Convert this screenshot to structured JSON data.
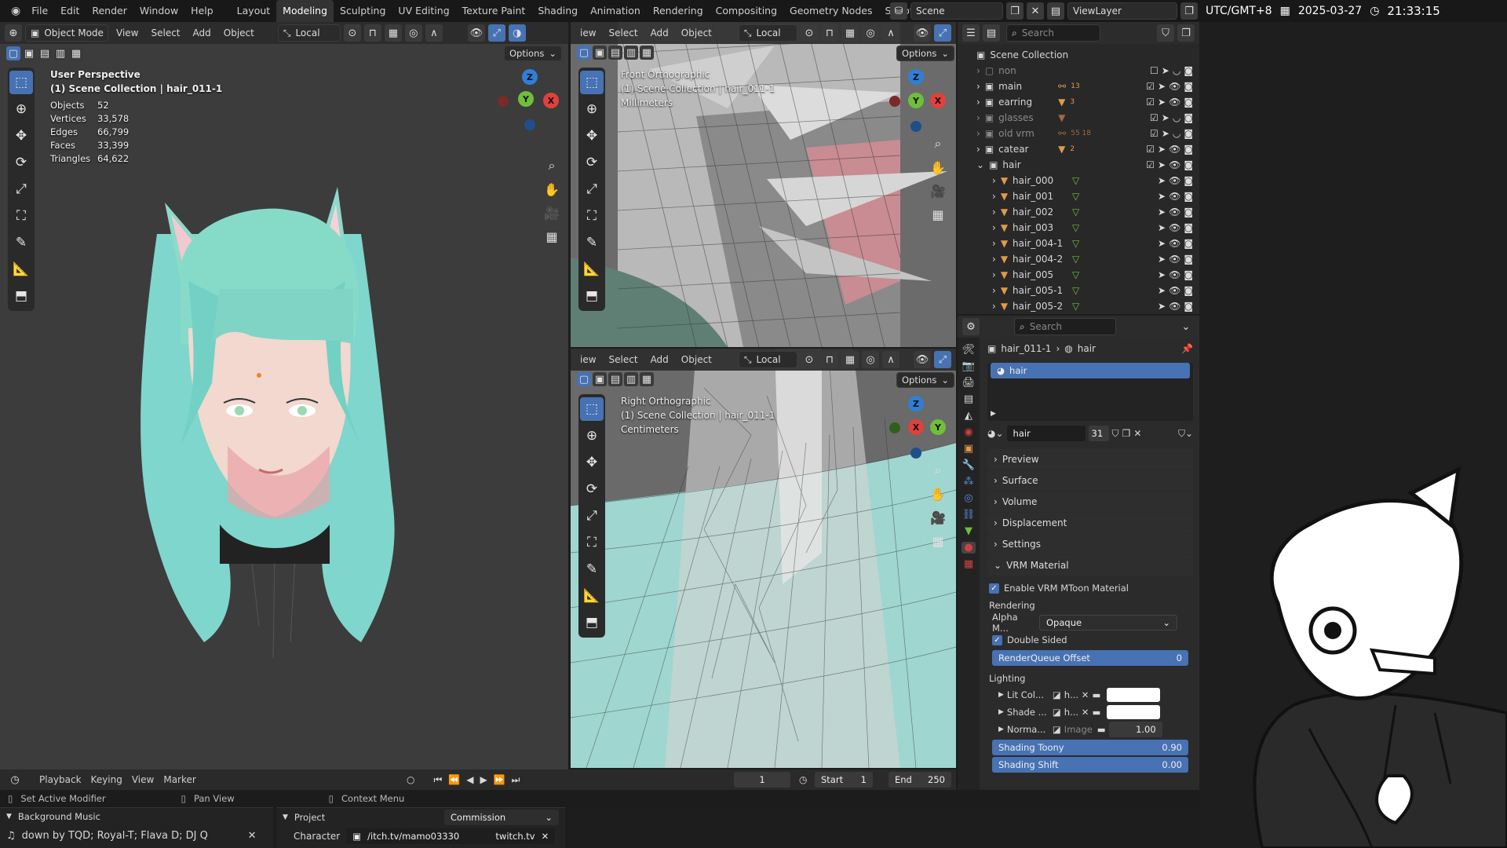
{
  "topbar": {
    "menus": [
      "File",
      "Edit",
      "Render",
      "Window",
      "Help"
    ],
    "workspaces": [
      "Layout",
      "Modeling",
      "Sculpting",
      "UV Editing",
      "Texture Paint",
      "Shading",
      "Animation",
      "Rendering",
      "Compositing",
      "Geometry Nodes",
      "Scripting"
    ],
    "active_workspace": "Modeling",
    "scene": "Scene",
    "view_layer": "ViewLayer"
  },
  "clock": {
    "timezone": "UTC/GMT+8",
    "date": "2025-03-27",
    "time": "21:33:15"
  },
  "viewport_main": {
    "mode": "Object Mode",
    "menus": [
      "View",
      "Select",
      "Add",
      "Object"
    ],
    "transform": "Local",
    "options": "Options",
    "view_name": "User Perspective",
    "collection": "(1) Scene Collection | hair_011-1",
    "stats": [
      {
        "label": "Objects",
        "value": "52"
      },
      {
        "label": "Vertices",
        "value": "33,578"
      },
      {
        "label": "Edges",
        "value": "66,799"
      },
      {
        "label": "Faces",
        "value": "33,399"
      },
      {
        "label": "Triangles",
        "value": "64,622"
      }
    ]
  },
  "viewport_front": {
    "menus": [
      "iew",
      "Select",
      "Add",
      "Object"
    ],
    "transform": "Local",
    "options": "Options",
    "view_name": "Front Orthographic",
    "collection": "(1) Scene Collection | hair_011-1",
    "units": "Millimeters"
  },
  "viewport_right": {
    "menus": [
      "iew",
      "Select",
      "Add",
      "Object"
    ],
    "transform": "Local",
    "options": "Options",
    "view_name": "Right Orthographic",
    "collection": "(1) Scene Collection | hair_011-1",
    "units": "Centimeters"
  },
  "outliner": {
    "search_placeholder": "Search",
    "root": "Scene Collection",
    "items": [
      {
        "name": "non",
        "badge": ""
      },
      {
        "name": "main",
        "badge": "13"
      },
      {
        "name": "earring",
        "badge": "3"
      },
      {
        "name": "glasses",
        "badge": ""
      },
      {
        "name": "old vrm",
        "badge": "55 18"
      },
      {
        "name": "catear",
        "badge": "2"
      },
      {
        "name": "hair",
        "badge": ""
      }
    ],
    "children": [
      "hair_000",
      "hair_001",
      "hair_002",
      "hair_003",
      "hair_004-1",
      "hair_004-2",
      "hair_005",
      "hair_005-1",
      "hair_005-2"
    ]
  },
  "properties": {
    "search_placeholder": "Search",
    "breadcrumb_object": "hair_011-1",
    "breadcrumb_material": "hair",
    "slot_name": "hair",
    "material_name": "hair",
    "users": "31",
    "sections": [
      "Preview",
      "Surface",
      "Volume",
      "Displacement",
      "Settings"
    ],
    "vrm_section": "VRM Material",
    "enable_mtoon": "Enable VRM MToon Material",
    "rendering_label": "Rendering",
    "alpha_label": "Alpha M...",
    "alpha_value": "Opaque",
    "double_sided": "Double Sided",
    "render_queue_label": "RenderQueue Offset",
    "render_queue_value": "0",
    "lighting_label": "Lighting",
    "lit_color": "Lit Col...",
    "shade_color": "Shade ...",
    "normal_map": "Norma...",
    "tex_h": "h...",
    "image_label": "Image",
    "normal_value": "1.00",
    "shading_toony_label": "Shading Toony",
    "shading_toony_value": "0.90",
    "shading_shift_label": "Shading Shift",
    "shading_shift_value": "0.00"
  },
  "timeline": {
    "menus": [
      "Playback",
      "Keying",
      "View",
      "Marker"
    ],
    "current_frame": "1",
    "start_label": "Start",
    "start": "1",
    "end_label": "End",
    "end": "250"
  },
  "statusbar": {
    "left": "Set Active Modifier",
    "middle": "Pan View",
    "right": "Context Menu"
  },
  "music_panel": {
    "title": "Background Music",
    "track": "down  by  TQD; Royal-T; Flava D; DJ Q"
  },
  "project_panel": {
    "title": "Project",
    "project_value": "Commission",
    "character_label": "Character",
    "character_value": "/itch.tv/mamo03330",
    "character_suffix": "twitch.tv"
  }
}
